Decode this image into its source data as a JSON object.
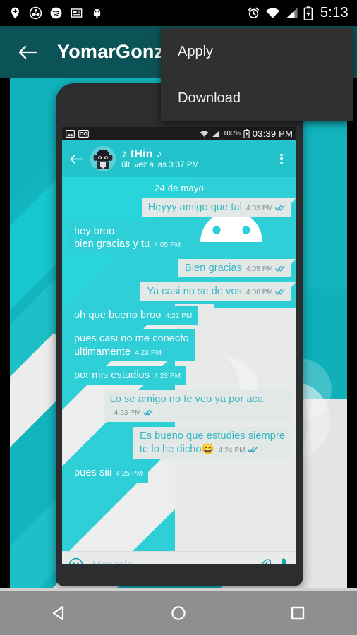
{
  "system_status_bar": {
    "icons_left": [
      "location-pin-plus-icon",
      "cast-circle-icon",
      "spotify-icon",
      "news-card-icon",
      "android-bot-icon"
    ],
    "icons_right": [
      "alarm-icon",
      "wifi-icon",
      "cellular-signal-icon",
      "battery-charging-icon"
    ],
    "clock": "5:13"
  },
  "appbar": {
    "back_icon": "back-arrow-icon",
    "title": "YomarGonz"
  },
  "overflow_menu": {
    "items": [
      {
        "label": "Apply"
      },
      {
        "label": "Download"
      }
    ]
  },
  "preview": {
    "wallpaper_colors": {
      "teal": "#12b5be",
      "teal_dark": "#0e9aa3",
      "white": "#eceeee"
    },
    "phone": {
      "inner_status_bar": {
        "icons_left": [
          "image-icon",
          "voicemail-icon"
        ],
        "icons_right": [
          "wifi-icon",
          "cellular-signal-icon",
          "battery-charging-icon"
        ],
        "battery_percent": "100%",
        "clock": "03:39 PM"
      },
      "chat_header": {
        "back_icon": "back-arrow-icon",
        "avatar": "contact-avatar",
        "contact_name": "♪ tHin ♪",
        "last_seen": "últ. vez a las 3:37 PM",
        "overflow_icon": "more-vertical-icon"
      },
      "chat": {
        "date_separator": "24 de mayo",
        "messages": [
          {
            "side": "out",
            "text": "Heyyy amigo que tal",
            "time": "4:03 PM",
            "ticks": true,
            "wide": false
          },
          {
            "side": "in",
            "text": "hey broo\nbien gracias y tu",
            "time": "4:05 PM",
            "ticks": false,
            "wide": false
          },
          {
            "side": "out",
            "text": "Bien gracias",
            "time": "4:05 PM",
            "ticks": true,
            "wide": false
          },
          {
            "side": "out",
            "text": "Ya casi no se de vos",
            "time": "4:06 PM",
            "ticks": true,
            "wide": false
          },
          {
            "side": "in",
            "text": "oh que bueno broo",
            "time": "4:22 PM",
            "ticks": false,
            "wide": false
          },
          {
            "side": "in",
            "text": "pues casi no me conecto\nultimamente",
            "time": "4:23 PM",
            "ticks": false,
            "wide": true
          },
          {
            "side": "in",
            "text": "por mis estudios",
            "time": "4:23 PM",
            "ticks": false,
            "wide": false
          },
          {
            "side": "out",
            "text": "Lo se amigo no te veo ya por aca",
            "time": "4:23 PM",
            "ticks": true,
            "wide": true
          },
          {
            "side": "out",
            "text": "Es bueno que estudies siempre\nte lo he dicho😄",
            "time": "4:24 PM",
            "ticks": true,
            "wide": true
          },
          {
            "side": "in",
            "text": "pues siii",
            "time": "4:25 PM",
            "ticks": false,
            "wide": false
          }
        ],
        "watermark": "android-robot-watermark"
      },
      "input_bar": {
        "emoji_icon": "emoji-smiley-icon",
        "placeholder": "Mensaje",
        "attach_icon": "paperclip-icon",
        "mic_icon": "microphone-icon"
      }
    }
  },
  "navbar": {
    "buttons": [
      {
        "name": "back-nav-button",
        "icon": "triangle-back-icon"
      },
      {
        "name": "home-nav-button",
        "icon": "circle-home-icon"
      },
      {
        "name": "recents-nav-button",
        "icon": "square-recents-icon"
      }
    ]
  }
}
